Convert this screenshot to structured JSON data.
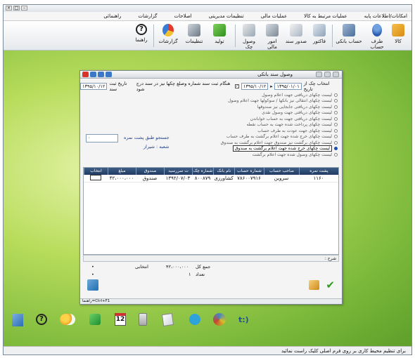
{
  "menubar": {
    "items": [
      "امکانات/اطلاعات پایه",
      "عملیات مرتبط به کالا",
      "عملیات مالی",
      "تنظیمات مدیریتی",
      "اصلاحات",
      "گزارشات",
      "راهنمائی"
    ]
  },
  "toolbar": {
    "items": [
      {
        "label": "کالا",
        "icon": "goods-icon"
      },
      {
        "label": "طرف حساب",
        "icon": "person-icon"
      },
      {
        "label": "حساب بانکی",
        "icon": "bank-account-icon"
      },
      {
        "label": "فاکتور",
        "icon": "invoice-icon"
      },
      {
        "label": "صدور سند",
        "icon": "issue-document-icon"
      },
      {
        "label": "امور مالی",
        "icon": "finance-icon"
      },
      {
        "label": "وصول چک",
        "icon": "collect-check-icon"
      },
      {
        "label": "تولید",
        "icon": "production-icon"
      },
      {
        "label": "تنظیمات",
        "icon": "settings-icon"
      },
      {
        "label": "گزارشات",
        "icon": "reports-icon"
      },
      {
        "label": "راهنما",
        "icon": "help-icon"
      }
    ]
  },
  "dialog": {
    "title": "وصول سند بانکی",
    "filter_label": "انتخاب چک از تاریخ",
    "date_from": "۱۳۹۵/۰۱/۰۱",
    "date_to": "۱۳۹۵/۱۰/۱۲",
    "register_date_label": "تاریخ ثبت سند",
    "register_date": "۱۳۹۵/۱۰/۱۲",
    "checkbox_label": "هنگام ثبت سند شماره وصلع چکها نیز در سند درج شود",
    "radio_options": [
      "لیست چکهای دریافتی جهت اعلام وصول",
      "لیست چکهای انتقالی نیز بانکها / سوکولها جهت اعلام وصول",
      "لیست چکهای دریافتی جابجایی نیز صندوقها",
      "لیست چکهای دریافتی جهت وصول نقدی",
      "لیست چکهای دریافتی جهت به حساب خواباندن",
      "لیست چکهای پرداخت شده جهت به حساب نقطه",
      "لیست چکهای جهت عودت به طرف حساب",
      "لیست چکهای خرج شده جهت اعلام برگشت به طرف حساب",
      "لیست چکهای برگشت نیز صندوق جهت اعلام برگشت به صندوق",
      "لیست چکهای خرج شده جهت اعلام برگشت به صندوق",
      "لیست چکهای وصول شده جهت اعلام برگشت"
    ],
    "selected_radio_index": 9,
    "search_label": "جستجو طبق پشت نمره",
    "search_value": "۰",
    "branch_label": "شعبه : شیراز",
    "table": {
      "columns": [
        "پشت نمره",
        "صاحب حساب",
        "شماره حساب",
        "نام بانک",
        "شماره چک",
        "ت سررسید",
        "صندوق",
        "مبلغ",
        "انتخاب"
      ],
      "rows": [
        {
          "cells": [
            "۱۱۶۰",
            "سروین",
            "۷۸۶۰۰۷۹۱۶",
            "کشاورزی",
            "۸۰۰۸۷۹",
            "۱۳۹۲/۰۷/۰۳",
            "صندوق",
            "۴۲،۰۰۰،۰۰۰",
            ""
          ]
        }
      ]
    },
    "summary_label": "شرح :",
    "total_label": "جمع کل",
    "total_value": "۴۲،۰۰۰،۰۰۰",
    "selected_label": "انتخابی",
    "count_label": "تعداد",
    "count_value": "۱",
    "footer_text": "راهنما=Ctrl+F1"
  },
  "statusbar": {
    "text": "برای تنظیم محیط کاری بر روی فرم اصلی کلیک راست نمائید"
  },
  "dock": {
    "icons": [
      "exit-icon",
      "help-icon",
      "weather-icon",
      "phone-icon",
      "calendar-icon",
      "calculator-icon",
      "notes-icon",
      "telegram-icon",
      "tools-icon",
      "logo-icon"
    ],
    "calendar_day": "12"
  }
}
